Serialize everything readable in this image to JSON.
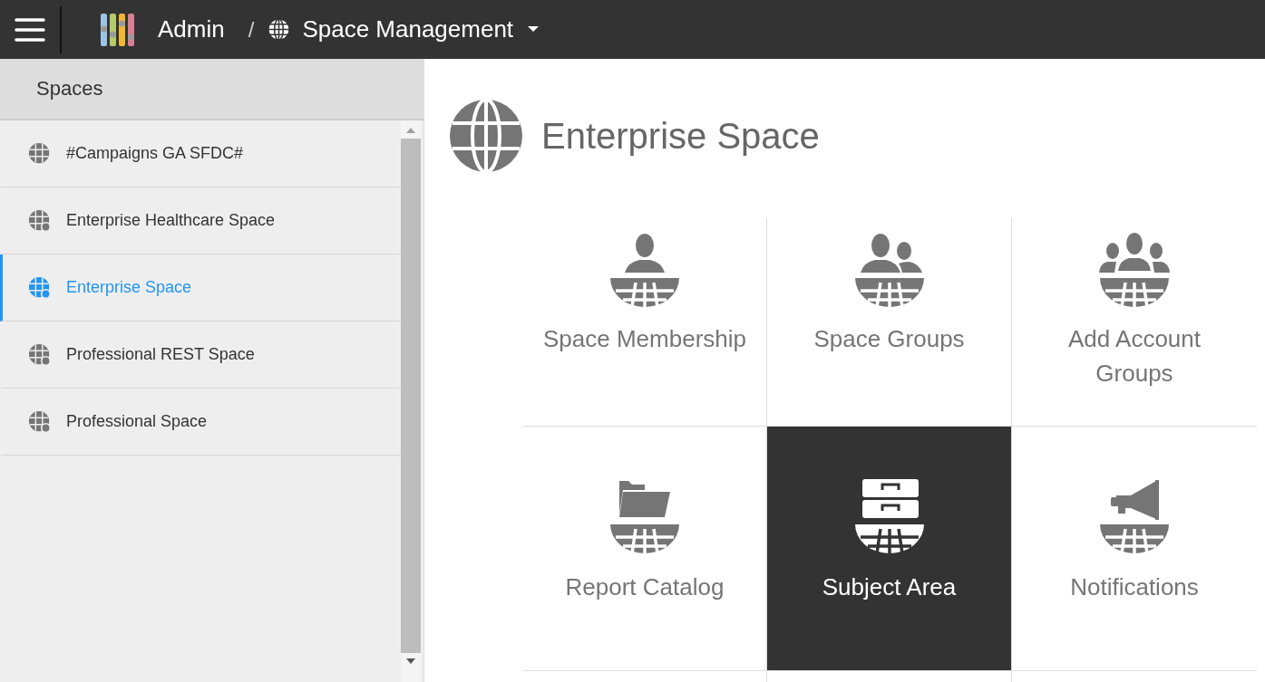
{
  "topbar": {
    "app": "Admin",
    "separator": "/",
    "section": "Space Management"
  },
  "sidebar": {
    "title": "Spaces",
    "items": [
      {
        "label": "#Campaigns GA SFDC#",
        "kind": "plain",
        "selected": false
      },
      {
        "label": "Enterprise Healthcare Space",
        "kind": "badged",
        "selected": false
      },
      {
        "label": "Enterprise Space",
        "kind": "badged",
        "selected": true
      },
      {
        "label": "Professional REST Space",
        "kind": "badged",
        "selected": false
      },
      {
        "label": "Professional Space",
        "kind": "badged",
        "selected": false
      }
    ]
  },
  "main": {
    "title": "Enterprise Space",
    "tiles": [
      {
        "label": "Space Membership",
        "kind": "person",
        "selected": false
      },
      {
        "label": "Space Groups",
        "kind": "pair",
        "selected": false
      },
      {
        "label": "Add Account Groups",
        "kind": "trio",
        "selected": false
      },
      {
        "label": "Report Catalog",
        "kind": "folder",
        "selected": false
      },
      {
        "label": "Subject Area",
        "kind": "cabinet",
        "selected": true
      },
      {
        "label": "Notifications",
        "kind": "megaphone",
        "selected": false
      }
    ]
  }
}
